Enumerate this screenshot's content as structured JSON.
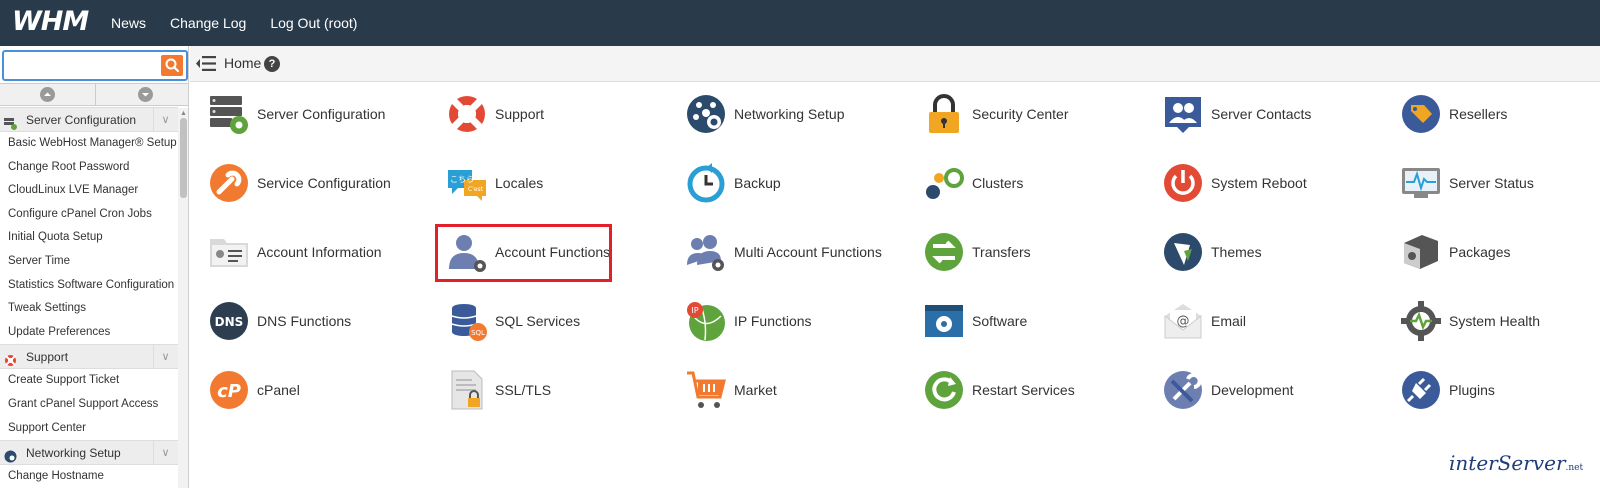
{
  "topbar": {
    "logo": "WHM",
    "nav": [
      "News",
      "Change Log",
      "Log Out (root)"
    ]
  },
  "search": {
    "value": "",
    "placeholder": ""
  },
  "breadcrumb": {
    "home": "Home",
    "help": "?"
  },
  "sidebar": {
    "sections": [
      {
        "title": "Server Configuration",
        "icon": "server-config-icon",
        "items": [
          "Basic WebHost Manager® Setup",
          "Change Root Password",
          "CloudLinux LVE Manager",
          "Configure cPanel Cron Jobs",
          "Initial Quota Setup",
          "Server Time",
          "Statistics Software Configuration",
          "Tweak Settings",
          "Update Preferences"
        ]
      },
      {
        "title": "Support",
        "icon": "lifebuoy-icon",
        "items": [
          "Create Support Ticket",
          "Grant cPanel Support Access",
          "Support Center"
        ]
      },
      {
        "title": "Networking Setup",
        "icon": "network-icon",
        "items": [
          "Change Hostname"
        ]
      }
    ]
  },
  "grid": [
    [
      "Server Configuration",
      "Support",
      "Networking Setup",
      "Security Center",
      "Server Contacts",
      "Resellers"
    ],
    [
      "Service Configuration",
      "Locales",
      "Backup",
      "Clusters",
      "System Reboot",
      "Server Status"
    ],
    [
      "Account Information",
      "Account Functions",
      "Multi Account Functions",
      "Transfers",
      "Themes",
      "Packages"
    ],
    [
      "DNS Functions",
      "SQL Services",
      "IP Functions",
      "Software",
      "Email",
      "System Health"
    ],
    [
      "cPanel",
      "SSL/TLS",
      "Market",
      "Restart Services",
      "Development",
      "Plugins"
    ]
  ],
  "icon_text": {
    "dns": "DNS",
    "sql": "SQL",
    "cpanel": "cP",
    "ip": "IP",
    "locales": "こちら"
  },
  "highlighted_tile": "Account Functions",
  "brand": {
    "text": "interServer",
    "suffix": ".net"
  },
  "colors": {
    "topbar": "#293a4a",
    "accent": "#f27a30",
    "highlight": "#e3202a"
  }
}
